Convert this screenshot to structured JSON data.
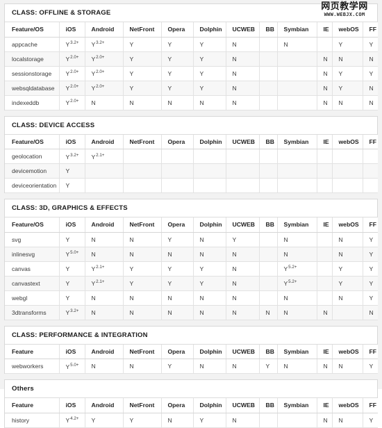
{
  "watermark": {
    "chinese": "网页教学网",
    "url": "WWW.WEBJX.COM"
  },
  "columns_feature_os": [
    "Feature/OS",
    "iOS",
    "Android",
    "NetFront",
    "Opera",
    "Dolphin",
    "UCWEB",
    "BB",
    "Symbian",
    "IE",
    "webOS",
    "FF"
  ],
  "columns_feature": [
    "Feature",
    "iOS",
    "Android",
    "NetFront",
    "Opera",
    "Dolphin",
    "UCWEB",
    "BB",
    "Symbian",
    "IE",
    "webOS",
    "FF"
  ],
  "sections": [
    {
      "title": "CLASS: OFFLINE & STORAGE",
      "header_key": "columns_feature_os",
      "rows": [
        {
          "feature": "appcache",
          "values": [
            "Y 3.2+",
            "Y 3.2+",
            "Y",
            "Y",
            "Y",
            "N",
            "",
            "N",
            "",
            "Y",
            "Y"
          ]
        },
        {
          "feature": "localstorage",
          "values": [
            "Y 2.0+",
            "Y 2.0+",
            "Y",
            "Y",
            "Y",
            "N",
            "",
            "",
            "N",
            "N",
            "N"
          ]
        },
        {
          "feature": "sessionstorage",
          "values": [
            "Y 2.0+",
            "Y 2.0+",
            "Y",
            "Y",
            "Y",
            "N",
            "",
            "",
            "N",
            "Y",
            "Y"
          ]
        },
        {
          "feature": "websqldatabase",
          "values": [
            "Y 2.0+",
            "Y 2.0+",
            "Y",
            "Y",
            "Y",
            "N",
            "",
            "",
            "N",
            "Y",
            "N"
          ]
        },
        {
          "feature": "indexeddb",
          "values": [
            "Y 2.0+",
            "N",
            "N",
            "N",
            "N",
            "N",
            "",
            "",
            "N",
            "N",
            "N"
          ]
        }
      ]
    },
    {
      "title": "CLASS: DEVICE ACCESS",
      "header_key": "columns_feature_os",
      "rows": [
        {
          "feature": "geolocation",
          "values": [
            "Y 3.2+",
            "Y 2.1+",
            "",
            "",
            "",
            "",
            "",
            "",
            "",
            "",
            ""
          ]
        },
        {
          "feature": "devicemotion",
          "values": [
            "Y",
            "",
            "",
            "",
            "",
            "",
            "",
            "",
            "",
            "",
            ""
          ]
        },
        {
          "feature": "deviceorientation",
          "values": [
            "Y",
            "",
            "",
            "",
            "",
            "",
            "",
            "",
            "",
            "",
            ""
          ]
        }
      ]
    },
    {
      "title": "CLASS: 3D, GRAPHICS & EFFECTS",
      "header_key": "columns_feature_os",
      "rows": [
        {
          "feature": "svg",
          "values": [
            "Y",
            "N",
            "N",
            "Y",
            "N",
            "Y",
            "",
            "N",
            "",
            "N",
            "Y"
          ]
        },
        {
          "feature": "inlinesvg",
          "values": [
            "Y 5.0+",
            "N",
            "N",
            "N",
            "N",
            "N",
            "",
            "N",
            "",
            "N",
            "Y"
          ]
        },
        {
          "feature": "canvas",
          "values": [
            "Y",
            "Y 2.1+",
            "Y",
            "Y",
            "Y",
            "N",
            "",
            "Y 5.2+",
            "",
            "Y",
            "Y"
          ]
        },
        {
          "feature": "canvastext",
          "values": [
            "Y",
            "Y 2.1+",
            "Y",
            "Y",
            "Y",
            "N",
            "",
            "Y 5.2+",
            "",
            "Y",
            "Y"
          ]
        },
        {
          "feature": "webgl",
          "values": [
            "Y",
            "N",
            "N",
            "N",
            "N",
            "N",
            "",
            "N",
            "",
            "N",
            "Y"
          ]
        },
        {
          "feature": "3dtransforms",
          "values": [
            "Y 3.2+",
            "N",
            "N",
            "N",
            "N",
            "N",
            "N",
            "N",
            "N",
            "",
            "N"
          ]
        }
      ]
    },
    {
      "title": "CLASS: PERFORMANCE & INTEGRATION",
      "header_key": "columns_feature",
      "rows": [
        {
          "feature": "webworkers",
          "values": [
            "Y 5.0+",
            "N",
            "N",
            "Y",
            "N",
            "N",
            "Y",
            "N",
            "N",
            "N",
            "Y"
          ]
        }
      ]
    },
    {
      "title": "Others",
      "header_key": "columns_feature",
      "rows": [
        {
          "feature": "history",
          "values": [
            "Y 4.2+",
            "Y",
            "Y",
            "N",
            "Y",
            "N",
            "",
            "",
            "N",
            "N",
            "Y"
          ]
        }
      ]
    }
  ]
}
